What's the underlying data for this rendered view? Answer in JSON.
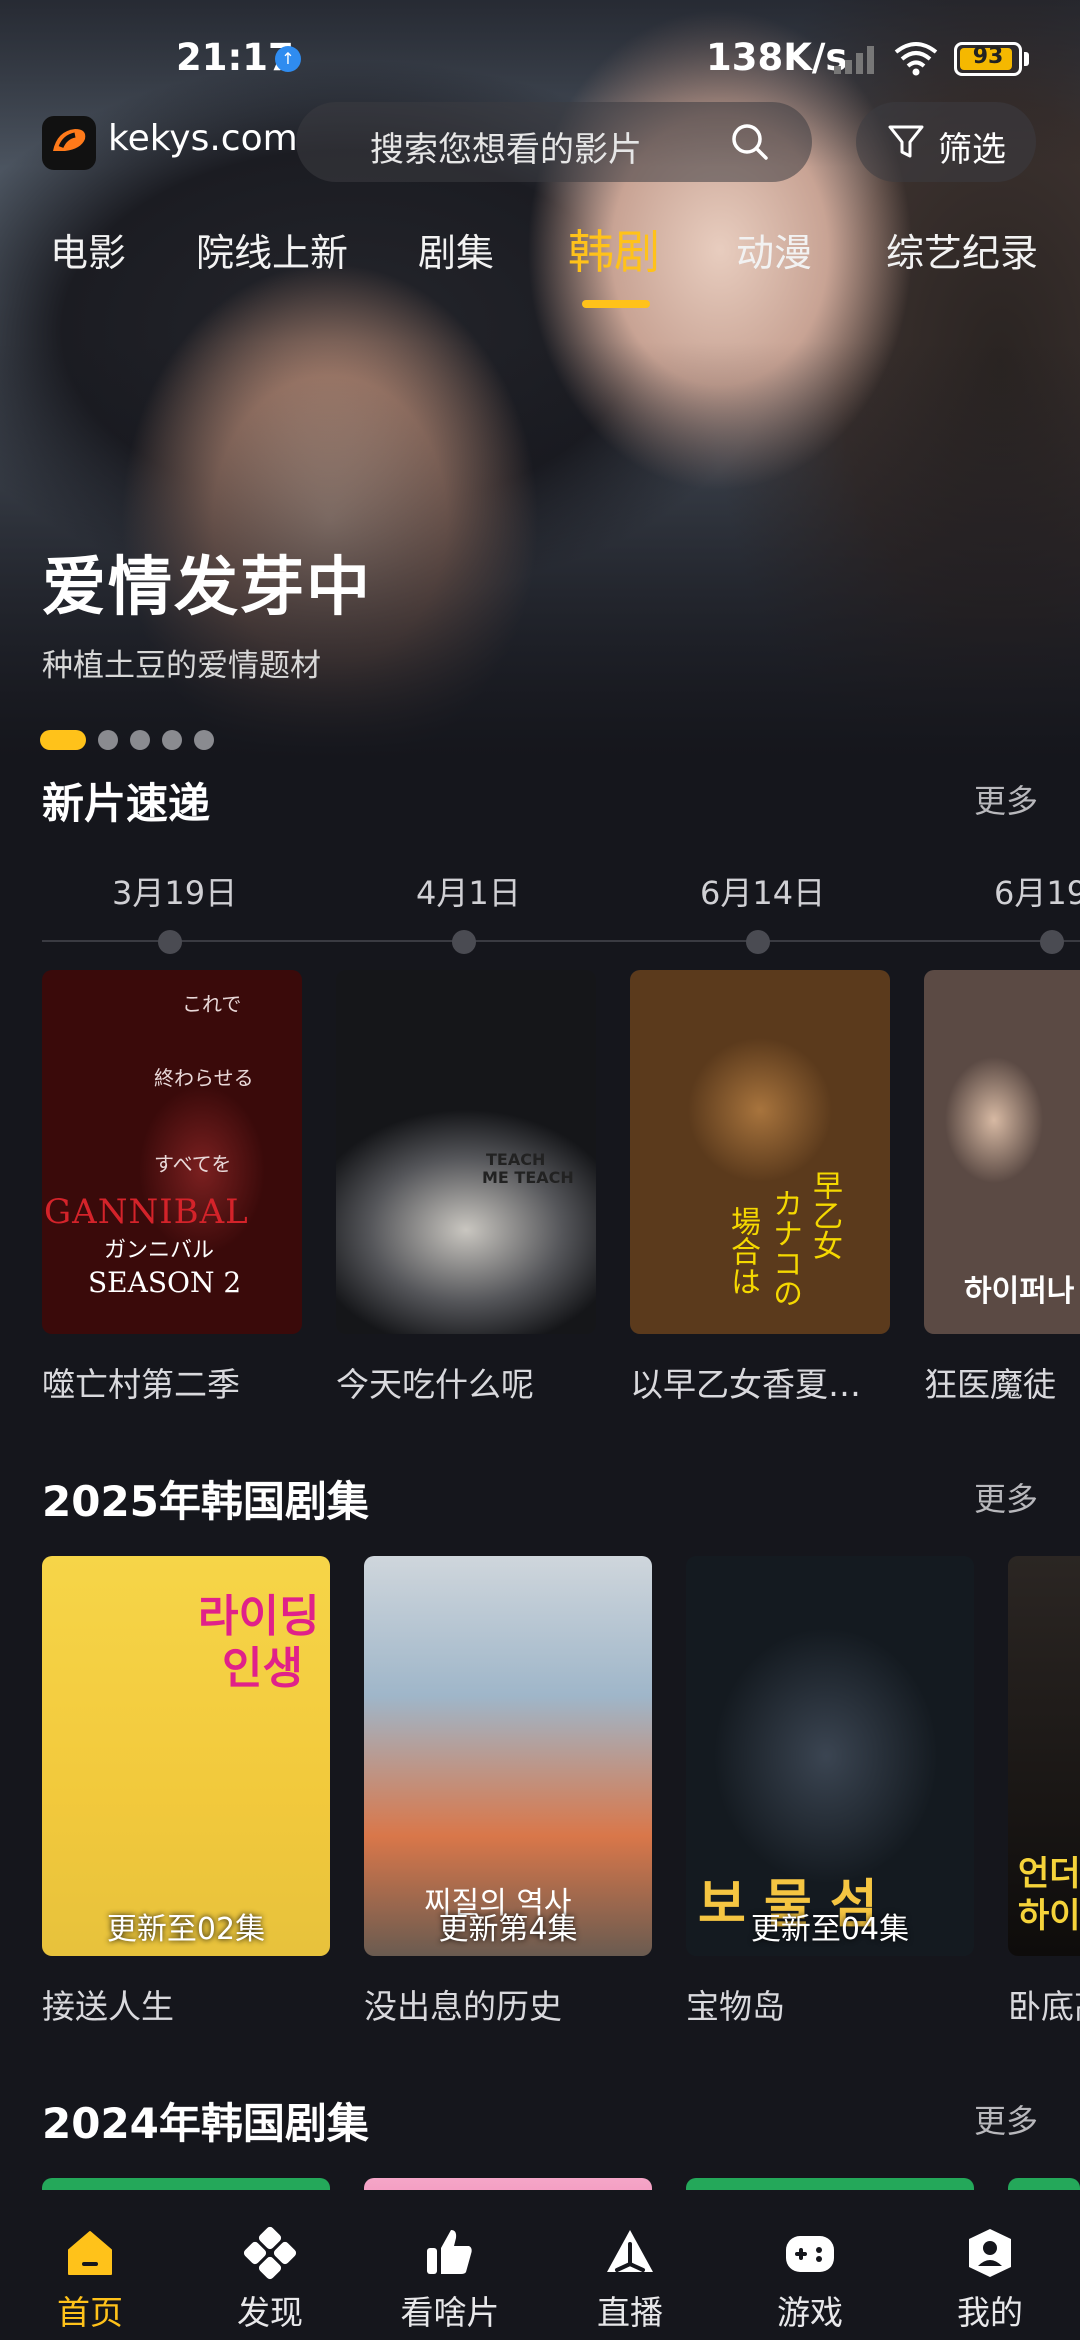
{
  "status_bar": {
    "time": "21:17",
    "net_speed": "138K/s",
    "battery": "93",
    "battery_level": 0.93
  },
  "header": {
    "site": "kekys.com",
    "search_placeholder": "搜索您想看的影片",
    "filter_label": "筛选"
  },
  "tabs": [
    "电影",
    "院线上新",
    "剧集",
    "韩剧",
    "动漫",
    "综艺纪录"
  ],
  "active_tab": "韩剧",
  "hero": {
    "title": "爱情发芽中",
    "subtitle": "种植土豆的爱情题材",
    "slides": 5,
    "active_slide": 1
  },
  "sections": {
    "new": {
      "title": "新片速递",
      "more": "更多",
      "dates": [
        "3月19日",
        "4月1日",
        "6月14日",
        "6月19"
      ],
      "items": [
        {
          "caption": "噬亡村第二季",
          "poster_text": [
            "これで",
            "終わらせる",
            "すべてを",
            "GANNIBAL",
            "ガンニバル",
            "SEASON 2"
          ]
        },
        {
          "caption": "今天吃什么呢",
          "poster_text": [
            "TEACH",
            "ME TEACH"
          ]
        },
        {
          "caption": "以早乙女香夏…",
          "poster_text": [
            "早乙女",
            "カナコの",
            "場合は"
          ]
        },
        {
          "caption": "狂医魔徒",
          "poster_text": [
            "하이퍼나"
          ]
        }
      ]
    },
    "k2025": {
      "title": "2025年韩国剧集",
      "more": "更多",
      "items": [
        {
          "caption": "接送人生",
          "badge": "更新至02集",
          "poster_text": [
            "라이딩",
            "인생"
          ]
        },
        {
          "caption": "没出息的历史",
          "badge": "更新第4集",
          "poster_text": [
            "찌질의 역사"
          ]
        },
        {
          "caption": "宝物岛",
          "badge": "更新至04集",
          "poster_text": [
            "보 물 섬"
          ]
        },
        {
          "caption": "卧底高",
          "badge": "",
          "poster_text": [
            "언더",
            "하이"
          ]
        }
      ]
    },
    "k2024": {
      "title": "2024年韩国剧集",
      "more": "更多"
    }
  },
  "bottom_nav": [
    {
      "label": "首页",
      "icon": "home-icon",
      "active": true
    },
    {
      "label": "发现",
      "icon": "discover-icon",
      "active": false
    },
    {
      "label": "看啥片",
      "icon": "thumbs-up-icon",
      "active": false
    },
    {
      "label": "直播",
      "icon": "live-icon",
      "active": false
    },
    {
      "label": "游戏",
      "icon": "gamepad-icon",
      "active": false
    },
    {
      "label": "我的",
      "icon": "profile-icon",
      "active": false
    }
  ],
  "colors": {
    "accent": "#ffc21a",
    "background": "#15161c"
  }
}
